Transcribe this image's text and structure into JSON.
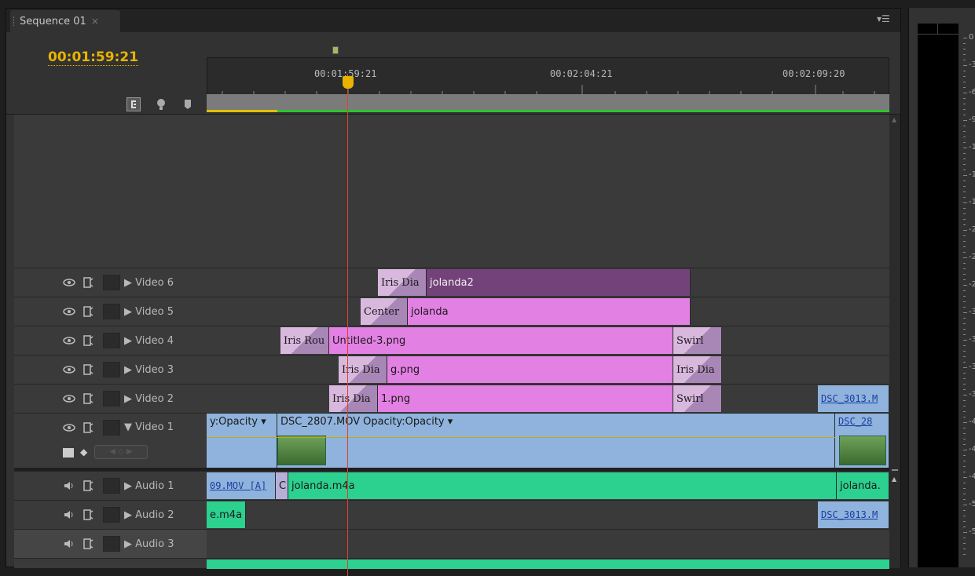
{
  "tab": {
    "title": "Sequence 01",
    "close": "×"
  },
  "timecode": "00:01:59:21",
  "ruler": {
    "labels": [
      "00:01:59:21",
      "00:02:04:21",
      "00:02:09:20"
    ]
  },
  "tracks": {
    "video": [
      {
        "name": "Video 6"
      },
      {
        "name": "Video 5"
      },
      {
        "name": "Video 4"
      },
      {
        "name": "Video 3"
      },
      {
        "name": "Video 2"
      },
      {
        "name": "Video 1"
      }
    ],
    "audio": [
      {
        "name": "Audio 1"
      },
      {
        "name": "Audio 2"
      },
      {
        "name": "Audio 3"
      }
    ]
  },
  "clips": {
    "v6_trans": "Iris Dia",
    "v6_clip": "jolanda2",
    "v5_trans": "Center",
    "v5_clip": "jolanda",
    "v4_trans": "Iris Rou",
    "v4_clip": "Untitled-3.png",
    "v4_trans2": "Swirl",
    "v3_trans": "Iris Dia",
    "v3_clip": "g.png",
    "v3_trans2": "Iris Dia",
    "v2_trans": "Iris Dia",
    "v2_clip": "1.png",
    "v2_trans2": "Swirl",
    "v2_clip2": "DSC_3013.M",
    "v1_clipA": "y:Opacity ▾",
    "v1_clipB": "DSC_2807.MOV",
    "v1_clipB_fx": "Opacity:Opacity ▾",
    "v1_clipC": "DSC_28",
    "a1_clipA": "09.MOV [A]",
    "a1_clipB": "C",
    "a1_clipC": "jolanda.m4a",
    "a1_clipD": "jolanda.",
    "a2_clipA": "e.m4a",
    "a2_clipB": "DSC_3013.M"
  },
  "colors": {
    "timecode": "#e9b400",
    "playhead": "#e0422a",
    "clip_pink": "#e380e3",
    "clip_purple": "#74427a",
    "clip_blue": "#8fb3dc",
    "clip_green": "#2cd08f"
  },
  "meter": {
    "labels": [
      "0",
      "-3",
      "-6",
      "-9",
      "-1",
      "-1",
      "-1",
      "-2",
      "-2",
      "-2",
      "-3",
      "-3",
      "-3",
      "-3",
      "-4",
      "-4",
      "-4",
      "-5",
      "-5"
    ]
  }
}
